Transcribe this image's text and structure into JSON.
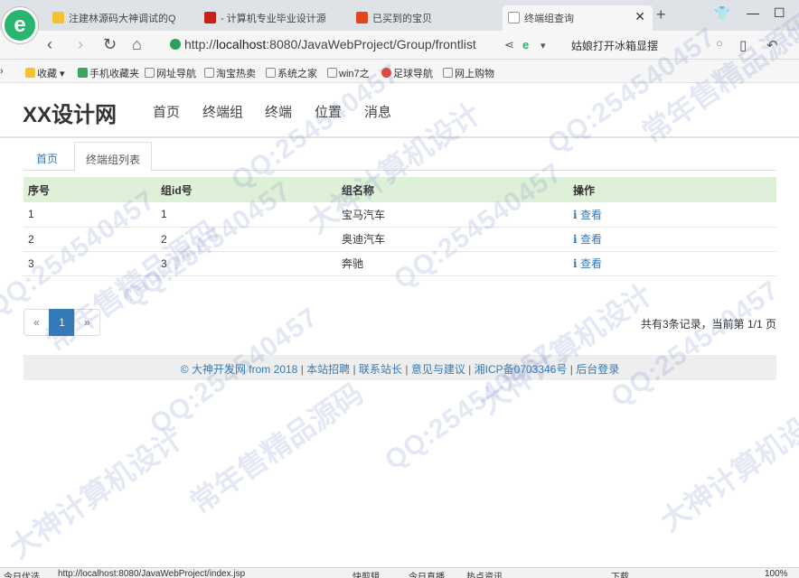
{
  "browser": {
    "logo_letter": "e",
    "tabs": [
      {
        "label": "注建林源码大神调试的Q"
      },
      {
        "label": "- 计算机专业毕业设计源"
      },
      {
        "label": "已买到的宝贝"
      },
      {
        "label": "终端组查询"
      }
    ],
    "new_tab": "+",
    "url_prefix": "http://",
    "url_host": "localhost",
    "url_rest": ":8080/JavaWebProject/Group/frontlist",
    "search_text": "姑娘打开冰箱显摆",
    "bookmarks": [
      "收藏",
      "手机收藏夹",
      "网址导航",
      "淘宝热卖",
      "系统之家",
      "win7之",
      "足球导航",
      "网上购物"
    ],
    "colors": {
      "tab_strip": "#dfe3e8",
      "brand_green": "#28b56f"
    }
  },
  "site": {
    "logo": "XX设计网",
    "nav": [
      "首页",
      "终端组",
      "终端",
      "位置",
      "消息"
    ]
  },
  "breadcrumbs": {
    "home": "首页",
    "current": "终端组列表"
  },
  "table": {
    "headers": [
      "序号",
      "组id号",
      "组名称",
      "操作"
    ],
    "rows": [
      {
        "seq": "1",
        "id": "1",
        "name": "宝马汽车",
        "action": "查看"
      },
      {
        "seq": "2",
        "id": "2",
        "name": "奥迪汽车",
        "action": "查看"
      },
      {
        "seq": "3",
        "id": "3",
        "name": "奔驰",
        "action": "查看"
      }
    ],
    "header_color": "#dff0d8"
  },
  "pagination": {
    "prev": "«",
    "current": "1",
    "next": "»",
    "summary": "共有3条记录，当前第 1/1 页"
  },
  "footer": {
    "copyright": "© 大神开发网 from 2018",
    "links": [
      "本站招聘",
      "联系站长",
      "意见与建议",
      "湘ICP备0703346号",
      "后台登录"
    ]
  },
  "statusbar": {
    "left": "今日优选",
    "url": "http://localhost:8080/JavaWebProject/index.jsp",
    "items": [
      "快剪辑",
      "今日直播",
      "热点资讯",
      "下载",
      "100%"
    ]
  },
  "watermark": {
    "qq": "QQ:254540457",
    "cn": "常年售精品源码",
    "cn2": "大神计算机设计"
  }
}
